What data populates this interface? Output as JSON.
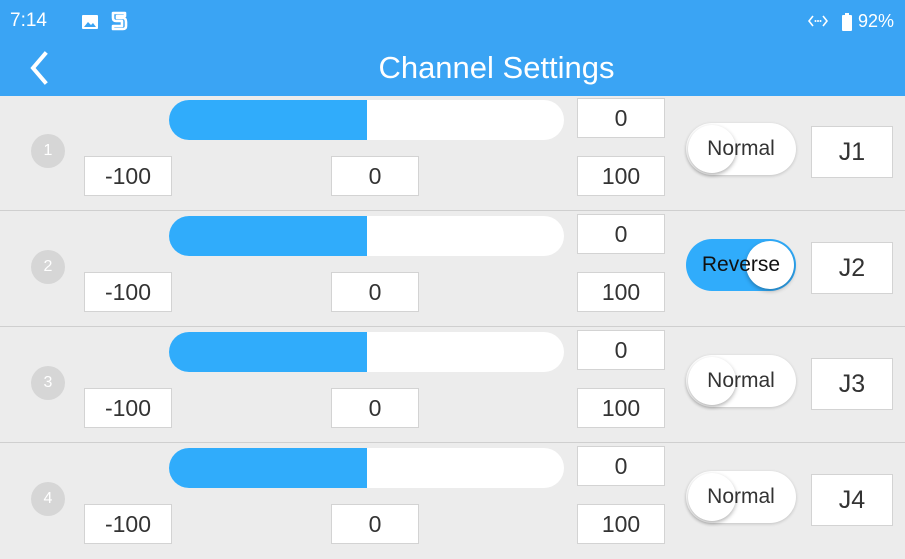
{
  "status_bar": {
    "time": "7:14",
    "battery": "92%",
    "icons": [
      "gallery-icon",
      "s-icon",
      "signal-icon",
      "battery-icon"
    ]
  },
  "header": {
    "title": "Channel Settings",
    "back_icon": "chevron-left-icon"
  },
  "channels": [
    {
      "number": "1",
      "value": "0",
      "min": "-100",
      "center": "0",
      "max": "100",
      "slider_fill": 0.5,
      "mode": "Normal",
      "mode_on": false,
      "assignment": "J1"
    },
    {
      "number": "2",
      "value": "0",
      "min": "-100",
      "center": "0",
      "max": "100",
      "slider_fill": 0.5,
      "mode": "Reverse",
      "mode_on": true,
      "assignment": "J2"
    },
    {
      "number": "3",
      "value": "0",
      "min": "-100",
      "center": "0",
      "max": "100",
      "slider_fill": 0.5,
      "mode": "Normal",
      "mode_on": false,
      "assignment": "J3"
    },
    {
      "number": "4",
      "value": "0",
      "min": "-100",
      "center": "0",
      "max": "100",
      "slider_fill": 0.5,
      "mode": "Normal",
      "mode_on": false,
      "assignment": "J4"
    }
  ],
  "colors": {
    "header": "#3aa4f4",
    "accent": "#30acfb",
    "background": "#ececec"
  }
}
